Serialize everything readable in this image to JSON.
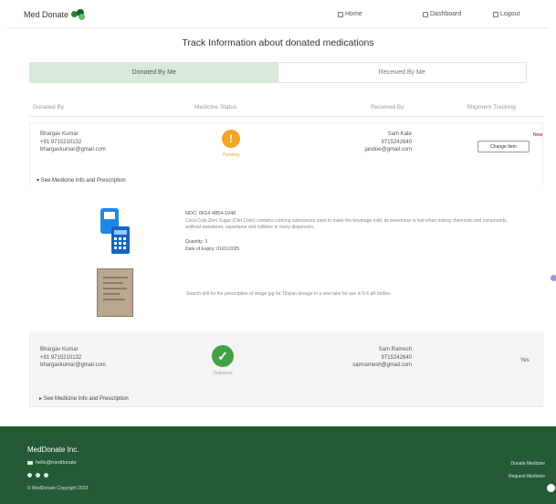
{
  "header": {
    "logo_text": "Med Donate",
    "nav": {
      "home": "Home",
      "dashboard": "Dashboard",
      "logout": "Logout"
    }
  },
  "page_title": "Track Information about donated medications",
  "tabs": [
    {
      "label": "Donated By Me",
      "active": true
    },
    {
      "label": "Received By Me",
      "active": false
    }
  ],
  "columns": {
    "donated_by": "Donated By",
    "status": "Medicine Status",
    "received_by": "Received By",
    "shipment": "Shipment Tracking"
  },
  "donations": [
    {
      "donor": {
        "name": "Bhargav Kumar",
        "phone": "+91 9715210132",
        "email": "bhargavkumar@gmail.com"
      },
      "status": {
        "label": "Pending",
        "icon": "exclamation-icon",
        "color": "#f5a623"
      },
      "receiver": {
        "name": "Sam Kate",
        "phone": "9715242640",
        "email": "jandoe@gmail.com"
      },
      "shipment_badge": "New",
      "change_label": "Change Item",
      "toggle_label": "See Medicine Info and Prescription",
      "medicine": {
        "ndc": "NDC: 0614-4854-1048",
        "description": "Coca-Cola Zero Sugar (Diet Coke) contains coloring substances used to make the beverage mild; its sweetness is lost when mixing chemicals and compounds, artificial sweetener, aspartame and caffeine in many dispensers.",
        "quantity": "Quantity: 3",
        "expiry": "Date of Expiry: 01/01/2025"
      },
      "prescription_note": "Search drill for the prescription of image jpg for Tibiyan dosage in a new take for use in 5-6 pill bottles"
    },
    {
      "donor": {
        "name": "Bhargav Kumar",
        "phone": "+91 9715210132",
        "email": "bhargavkumar@gmail.com"
      },
      "status": {
        "label": "Delivered",
        "icon": "checkmark-icon",
        "color": "#43a047"
      },
      "receiver": {
        "name": "Sam Ramesh",
        "phone": "9715242640",
        "email": "samramesh@gmail.com"
      },
      "shipment_text": "Yes",
      "toggle_label": "See Medicine Info and Prescription"
    }
  ],
  "footer": {
    "brand": "MedDonate Inc.",
    "email": "hello@meddonate",
    "copyright": "© MedDonate Copyright 2023",
    "links": [
      "Donate Medicine",
      "Request Medicine"
    ]
  }
}
